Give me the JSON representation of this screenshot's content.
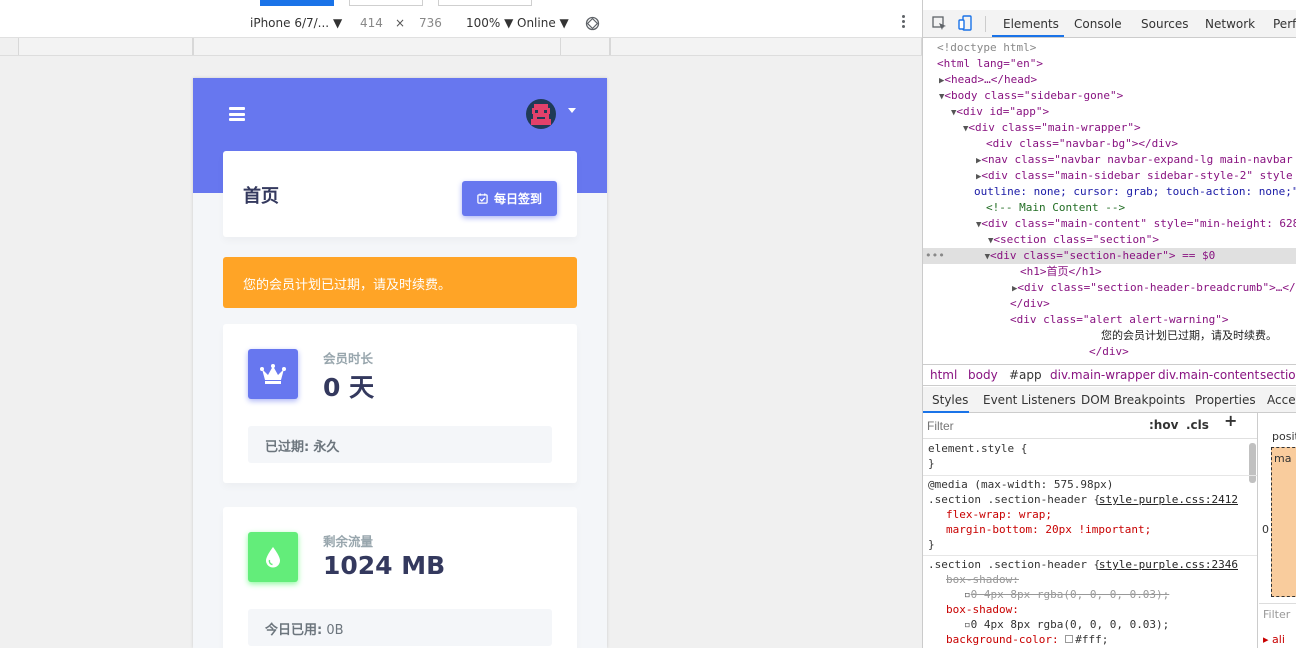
{
  "device_toolbar": {
    "device": "iPhone 6/7/...",
    "width": "414",
    "times": "×",
    "height": "736",
    "zoom": "100%",
    "network": "Online"
  },
  "app": {
    "page_title": "首页",
    "checkin_label": "每日签到",
    "alert_text": "您的会员计划已过期，请及时续费。",
    "member": {
      "label": "会员时长",
      "value": "0 天",
      "footer_key": "已过期:",
      "footer_value": "永久"
    },
    "traffic": {
      "label": "剩余流量",
      "value": "1024 MB",
      "footer_key": "今日已用:",
      "footer_value": "0B"
    },
    "colors": {
      "primary": "#6777ef",
      "warning": "#ffa426",
      "success": "#63ed7a"
    }
  },
  "devtools": {
    "tabs": [
      "Elements",
      "Console",
      "Sources",
      "Network",
      "Perf"
    ],
    "dom": [
      "<!doctype html>",
      "<html lang=\"en\">",
      "<head>…</head>",
      "<body class=\"sidebar-gone\">",
      "<div id=\"app\">",
      "<div class=\"main-wrapper\">",
      "<div class=\"navbar-bg\"></div>",
      "<nav class=\"navbar navbar-expand-lg main-navbar",
      "<div class=\"main-sidebar sidebar-style-2\" style",
      "outline: none; cursor: grab; touch-action: none;\"",
      "<!-- Main Content -->",
      "<div class=\"main-content\" style=\"min-height: 628",
      "<section class=\"section\">",
      "<div class=\"section-header\"> == $0",
      "<h1>首页</h1>",
      "<div class=\"section-header-breadcrumb\">…</div>",
      "</div>",
      "<div class=\"alert alert-warning\">",
      "您的会员计划已过期，请及时续费。",
      "</div>"
    ],
    "breadcrumbs": [
      "html",
      "body",
      "#app",
      "div.main-wrapper",
      "div.main-content",
      "section"
    ],
    "styles_tabs": [
      "Styles",
      "Event Listeners",
      "DOM Breakpoints",
      "Properties",
      "Acces"
    ],
    "filter_placeholder": "Filter",
    "hov": ":hov",
    "cls": ".cls",
    "plus": "+",
    "styles": {
      "element_style": "element.style {",
      "close": "}",
      "media": "@media (max-width: 575.98px)",
      "sel1": ".section .section-header {",
      "src1": "style-purple.css:2412",
      "p1": "flex-wrap: wrap;",
      "p2": "margin-bottom: 20px !important;",
      "sel2": ".section .section-header {",
      "src2": "style-purple.css:2346",
      "p3": "box-shadow: ",
      "p3v": "0 4px 8px rgba(0, 0, 0, 0.03);",
      "p4": "box-shadow:",
      "p4v": "0 4px 8px rgba(0, 0, 0, 0.03);",
      "p5": "background-color: ",
      "p5v": "#fff;"
    },
    "box_label": "positi",
    "box_margin": "ma",
    "box_zero": "0",
    "box_filter": "Filter",
    "box_ali": "ali"
  }
}
